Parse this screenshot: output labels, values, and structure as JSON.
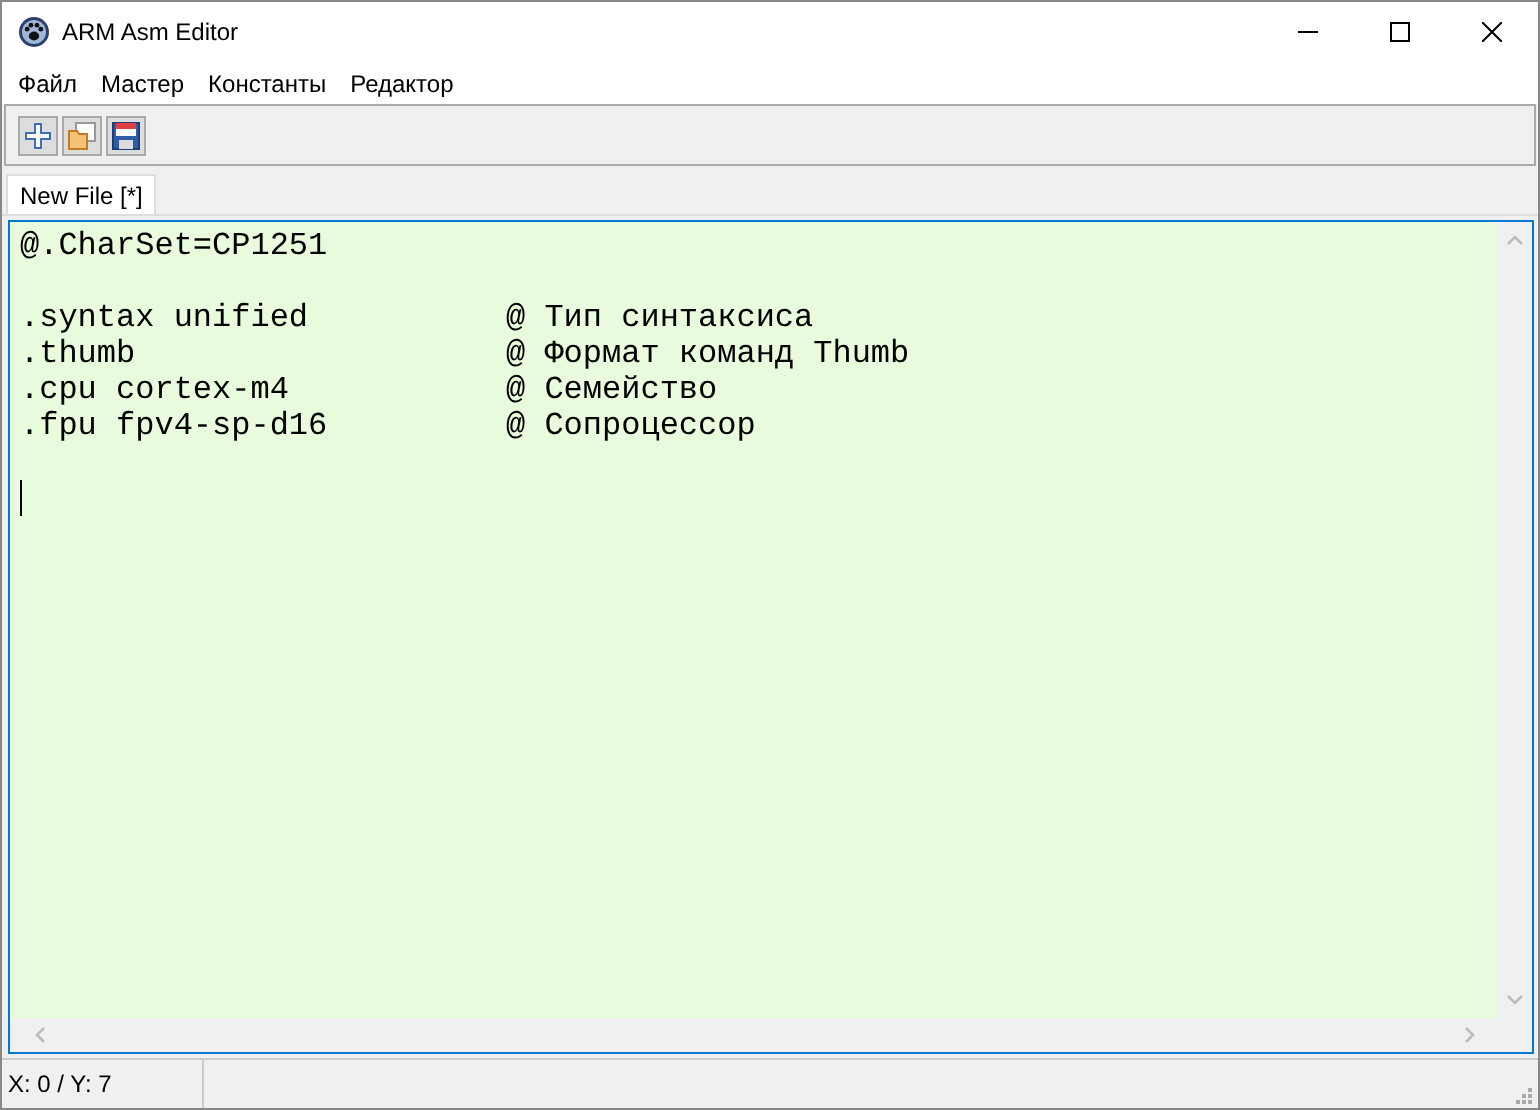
{
  "window": {
    "title": "ARM Asm Editor"
  },
  "menu": [
    "Файл",
    "Мастер",
    "Константы",
    "Редактор"
  ],
  "toolbar": [
    {
      "kind": "new"
    },
    {
      "kind": "open"
    },
    {
      "kind": "save"
    }
  ],
  "tabs": [
    {
      "label": "New File [*]",
      "selected": true
    }
  ],
  "editor": {
    "lines": [
      {
        "kind": "code",
        "code": "@.CharSet=CP1251"
      },
      {
        "kind": "blank"
      },
      {
        "kind": "code",
        "code": ".syntax unified",
        "comment": "@ Тип синтаксиса"
      },
      {
        "kind": "code",
        "code": ".thumb",
        "comment": "@ Формат команд Thumb"
      },
      {
        "kind": "code",
        "code": ".cpu cortex-m4",
        "comment": "@ Семейство"
      },
      {
        "kind": "code",
        "code": ".fpu fpv4-sp-d16",
        "comment": "@ Сопроцессор"
      },
      {
        "kind": "blank"
      },
      {
        "kind": "cursor"
      }
    ]
  },
  "status_bar": {
    "position": "X: 0 / Y: 7"
  }
}
